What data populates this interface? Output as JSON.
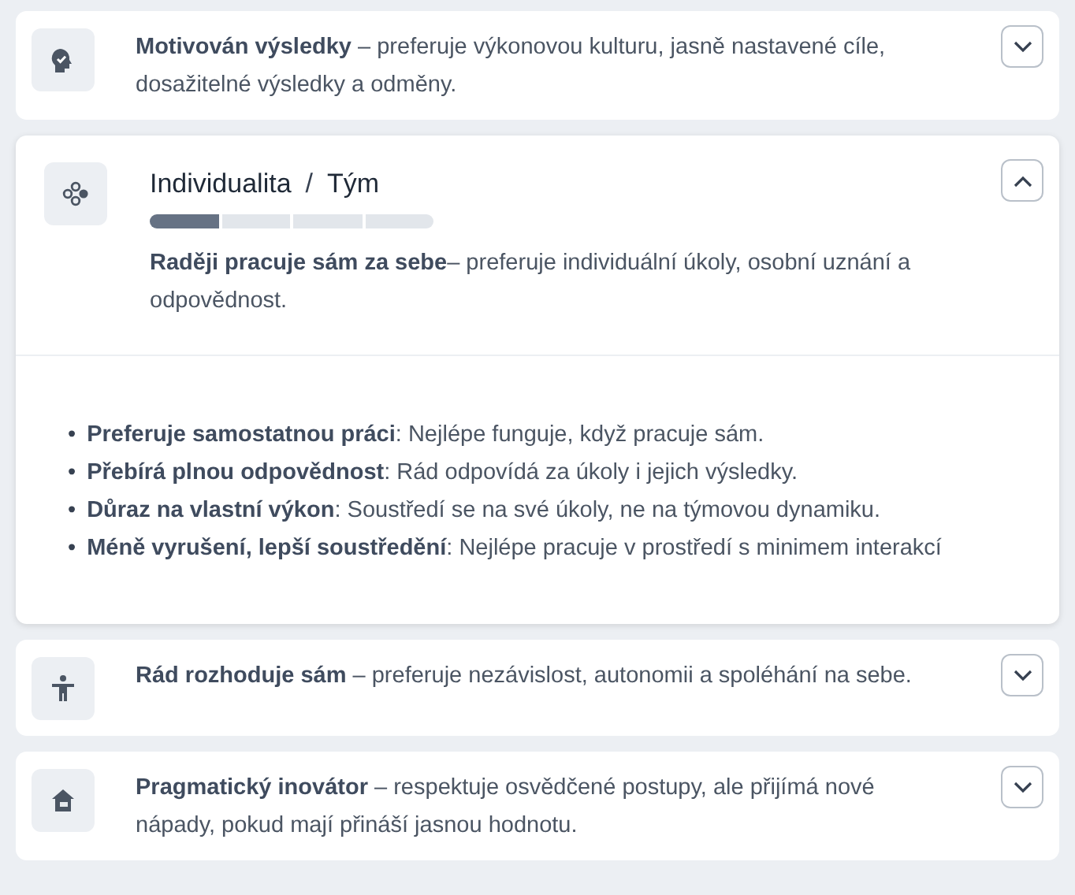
{
  "cards": [
    {
      "expanded": false,
      "text": "**Motivován výsledky** – preferuje výkonovou kulturu, jasně nastavené cíle, dosažitelné výsledky a odměny."
    },
    {
      "expanded": true,
      "title": "Individualita",
      "separator": "/",
      "opposite": "Tým",
      "level": 0.25,
      "text": "**Raději pracuje sám za sebe**– preferuje individuální úkoly, osobní uznání a odpovědnost.",
      "bullets": [
        {
          "marker": "•",
          "text": "**Preferuje samostatnou práci**: Nejlépe funguje, když pracuje sám."
        },
        {
          "marker": "•",
          "text": "**Přebírá plnou odpovědnost**: Rád odpovídá za úkoly i jejich výsledky."
        },
        {
          "marker": "•",
          "text": "**Důraz na vlastní výkon**: Soustředí se na své úkoly, ne na týmovou dynamiku."
        },
        {
          "marker": "•",
          "text": "**Méně vyrušení, lepší soustředění**: Nejlépe pracuje v prostředí s minimem interakcí"
        }
      ]
    },
    {
      "expanded": false,
      "text": "**Rád rozhoduje sám** – preferuje nezávislost, autonomii a spoléhání na sebe."
    },
    {
      "expanded": false,
      "text": "**Pragmatický inovátor** – respektuje osvědčené postupy, ale přijímá nové nápady, pokud mají přináší jasnou hodnotu."
    }
  ]
}
